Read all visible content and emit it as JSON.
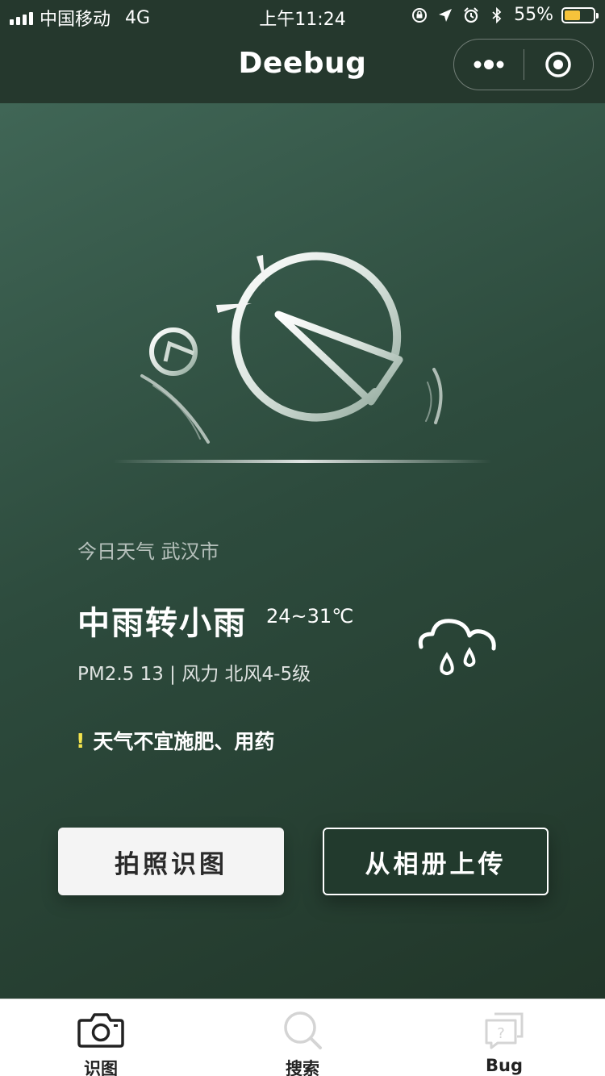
{
  "status_bar": {
    "carrier": "中国移动",
    "network": "4G",
    "time": "上午11:24",
    "battery_percent": "55%",
    "battery_level": 0.55,
    "battery_color": "#f6c33b"
  },
  "nav": {
    "title": "Deebug",
    "more_icon": "more-dots-icon",
    "close_icon": "target-circle-icon"
  },
  "weather": {
    "today_label": "今日天气 武汉市",
    "condition": "中雨转小雨",
    "temperature": "24~31℃",
    "details": "PM2.5 13 | 风力 北风4-5级",
    "warning_mark": "!",
    "warning_text": "天气不宜施肥、用药",
    "icon": "rain-cloud-icon"
  },
  "actions": {
    "photo_button": "拍照识图",
    "album_button": "从相册上传"
  },
  "tab_bar": {
    "tabs": [
      {
        "label": "识图",
        "icon": "camera-icon",
        "color": "#222222",
        "active": true
      },
      {
        "label": "搜索",
        "icon": "search-icon",
        "color": "#222222",
        "active": false
      },
      {
        "label": "Bug",
        "icon": "question-chat-icon",
        "color": "#222222",
        "active": false
      }
    ]
  },
  "colors": {
    "header_bg": "#25382d",
    "main_gradient_start": "#406656",
    "main_gradient_end": "#213629",
    "warning_accent": "#f3e34d"
  }
}
